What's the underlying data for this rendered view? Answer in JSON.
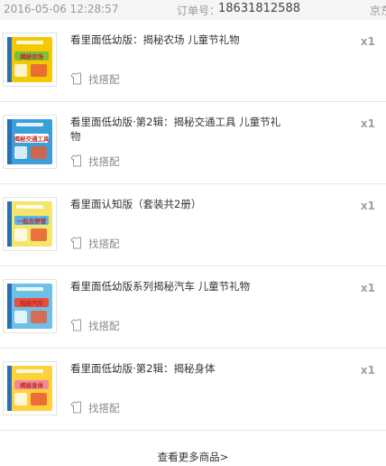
{
  "order": {
    "datetime": "2016-05-06 12:28:57",
    "order_label": "订单号：",
    "order_number": "18631812588",
    "shop_partial": "京东"
  },
  "items": [
    {
      "title": "看里面低幼版：揭秘农场 儿童节礼物",
      "qty": "x1",
      "match_label": "找搭配",
      "cover_text": "揭秘农场",
      "cover_color": "#f6c800",
      "cover_accent": "#7bbf3a"
    },
    {
      "title": "看里面低幼版·第2辑：揭秘交通工具 儿童节礼物",
      "qty": "x1",
      "match_label": "找搭配",
      "cover_text": "揭秘交通工具",
      "cover_color": "#3aa0d8",
      "cover_accent": "#ffffff"
    },
    {
      "title": "看里面认知版（套装共2册）",
      "qty": "x1",
      "match_label": "找搭配",
      "cover_text": "一起去野营",
      "cover_color": "#f3e66a",
      "cover_accent": "#58b7e3"
    },
    {
      "title": "看里面低幼版系列揭秘汽车 儿童节礼物",
      "qty": "x1",
      "match_label": "找搭配",
      "cover_text": "揭秘汽车",
      "cover_color": "#6fc0e8",
      "cover_accent": "#e6503a"
    },
    {
      "title": "看里面低幼版·第2辑：揭秘身体",
      "qty": "x1",
      "match_label": "找搭配",
      "cover_text": "揭秘身体",
      "cover_color": "#ffd23a",
      "cover_accent": "#f08a9a"
    }
  ],
  "footer": {
    "more_label": "查看更多商品>"
  },
  "icons": {
    "match": "shirt-icon"
  }
}
